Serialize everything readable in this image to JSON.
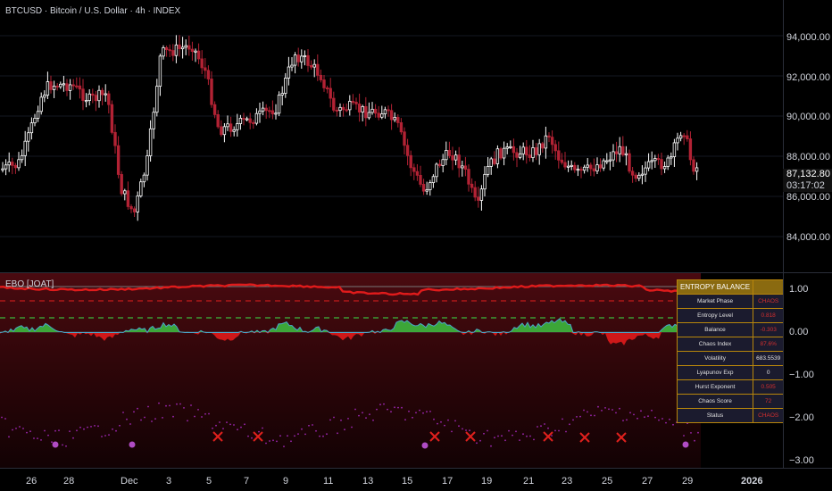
{
  "header": {
    "title": "BTCUSD · Bitcoin / U.S. Dollar · 4h · INDEX"
  },
  "indicator": {
    "label": "EBO [JOAT]"
  },
  "price_axis": {
    "ticks": [
      "94,000.00",
      "92,000.00",
      "90,000.00",
      "88,000.00",
      "86,000.00",
      "84,000.00"
    ]
  },
  "last_price": {
    "value": "87,132.80",
    "countdown": "03:17:02"
  },
  "indicator_axis": {
    "ticks": [
      "1.00",
      "0.00",
      "−1.00",
      "−2.00",
      "−3.00"
    ]
  },
  "time_axis": {
    "ticks": [
      "26",
      "28",
      "Dec",
      "3",
      "5",
      "7",
      "9",
      "11",
      "13",
      "15",
      "17",
      "19",
      "21",
      "23",
      "25",
      "27",
      "29",
      "2026"
    ]
  },
  "table": {
    "title": "ENTROPY BALANCE",
    "rows": [
      {
        "key": "Market Phase",
        "value": "CHAOS"
      },
      {
        "key": "Entropy Level",
        "value": "0.818"
      },
      {
        "key": "Balance",
        "value": "-0.303"
      },
      {
        "key": "Chaos Index",
        "value": "87.6%"
      },
      {
        "key": "Volatility",
        "value": "683.5539"
      },
      {
        "key": "Lyapunov Exp",
        "value": "0"
      },
      {
        "key": "Hurst Exponent",
        "value": "0.505"
      },
      {
        "key": "Chaos Score",
        "value": "72"
      },
      {
        "key": "Status",
        "value": "CHAOS"
      }
    ]
  },
  "colors": {
    "up": "#ffffff",
    "down": "#b22234",
    "entropy_line": "#e01b1b",
    "balance_pos": "#3db83d",
    "balance_neg": "#e01b1b",
    "dots": "#9c27b0",
    "table_border": "#b8860b"
  }
}
